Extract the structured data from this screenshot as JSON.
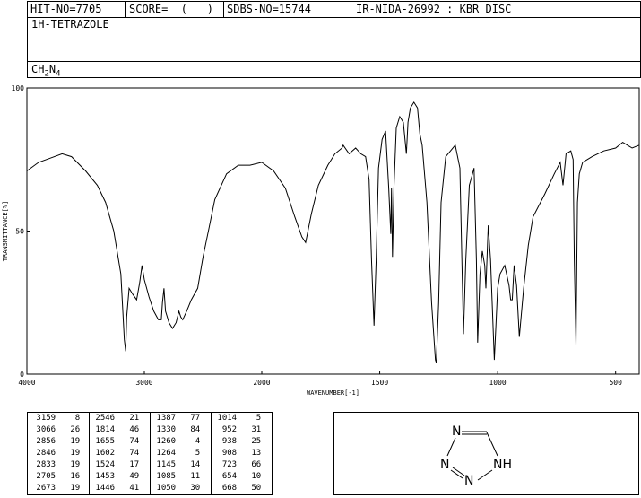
{
  "header": {
    "hit_no": "HIT-NO=7705",
    "score": "SCORE=  (   )",
    "sdbs_no": "SDBS-NO=15744",
    "ir_info": "IR-NIDA-26992 : KBR DISC"
  },
  "compound": {
    "name": "1H-TETRAZOLE",
    "formula_parts": [
      "CH",
      "2",
      "N",
      "4"
    ]
  },
  "chart_data": {
    "type": "line",
    "title": "",
    "xlabel": "WAVENUMBER[-1]",
    "ylabel": "TRANSMITTANCE[%]",
    "xlim": [
      4000,
      400
    ],
    "ylim": [
      0,
      100
    ],
    "x_ticks": [
      4000,
      3000,
      2000,
      1500,
      1000,
      500
    ],
    "x_tick_labels": [
      "4000",
      "3000",
      "2000",
      "1500",
      "1000",
      "500"
    ],
    "y_ticks": [
      0,
      50,
      100
    ],
    "y_tick_labels": [
      "0",
      "50",
      "100"
    ],
    "grid": false,
    "series": [
      {
        "points": [
          [
            4000,
            71
          ],
          [
            3900,
            74
          ],
          [
            3800,
            75.5
          ],
          [
            3700,
            77
          ],
          [
            3620,
            76
          ],
          [
            3500,
            71
          ],
          [
            3400,
            66
          ],
          [
            3330,
            60
          ],
          [
            3260,
            50
          ],
          [
            3200,
            35
          ],
          [
            3170,
            12
          ],
          [
            3159,
            8
          ],
          [
            3150,
            20
          ],
          [
            3130,
            30
          ],
          [
            3100,
            28
          ],
          [
            3066,
            26
          ],
          [
            3040,
            32
          ],
          [
            3020,
            38
          ],
          [
            3000,
            33
          ],
          [
            2960,
            27
          ],
          [
            2920,
            22
          ],
          [
            2880,
            19
          ],
          [
            2856,
            19
          ],
          [
            2846,
            25
          ],
          [
            2833,
            30
          ],
          [
            2820,
            22
          ],
          [
            2790,
            18
          ],
          [
            2760,
            16
          ],
          [
            2730,
            18
          ],
          [
            2705,
            22
          ],
          [
            2690,
            20
          ],
          [
            2673,
            19
          ],
          [
            2640,
            22
          ],
          [
            2600,
            26
          ],
          [
            2546,
            30
          ],
          [
            2500,
            41
          ],
          [
            2450,
            51
          ],
          [
            2400,
            61
          ],
          [
            2300,
            70
          ],
          [
            2200,
            73
          ],
          [
            2100,
            73
          ],
          [
            2000,
            74
          ],
          [
            1950,
            71
          ],
          [
            1900,
            65
          ],
          [
            1860,
            55
          ],
          [
            1830,
            48
          ],
          [
            1814,
            46
          ],
          [
            1790,
            56
          ],
          [
            1760,
            66
          ],
          [
            1720,
            73
          ],
          [
            1690,
            77
          ],
          [
            1660,
            79
          ],
          [
            1655,
            80
          ],
          [
            1630,
            77
          ],
          [
            1602,
            79
          ],
          [
            1580,
            77
          ],
          [
            1560,
            76
          ],
          [
            1545,
            68
          ],
          [
            1535,
            40
          ],
          [
            1524,
            17
          ],
          [
            1515,
            40
          ],
          [
            1505,
            72
          ],
          [
            1490,
            82
          ],
          [
            1475,
            85
          ],
          [
            1462,
            65
          ],
          [
            1453,
            49
          ],
          [
            1450,
            65
          ],
          [
            1446,
            41
          ],
          [
            1440,
            65
          ],
          [
            1430,
            86
          ],
          [
            1415,
            90
          ],
          [
            1400,
            88
          ],
          [
            1387,
            77
          ],
          [
            1380,
            88
          ],
          [
            1370,
            93
          ],
          [
            1355,
            95
          ],
          [
            1340,
            93
          ],
          [
            1330,
            84
          ],
          [
            1320,
            80
          ],
          [
            1300,
            60
          ],
          [
            1280,
            25
          ],
          [
            1264,
            5
          ],
          [
            1260,
            4
          ],
          [
            1250,
            25
          ],
          [
            1240,
            60
          ],
          [
            1220,
            76
          ],
          [
            1200,
            78
          ],
          [
            1180,
            80
          ],
          [
            1160,
            72
          ],
          [
            1145,
            14
          ],
          [
            1135,
            40
          ],
          [
            1120,
            66
          ],
          [
            1110,
            69
          ],
          [
            1100,
            72
          ],
          [
            1090,
            40
          ],
          [
            1085,
            11
          ],
          [
            1075,
            35
          ],
          [
            1065,
            43
          ],
          [
            1055,
            38
          ],
          [
            1050,
            30
          ],
          [
            1040,
            52
          ],
          [
            1030,
            40
          ],
          [
            1014,
            5
          ],
          [
            1000,
            30
          ],
          [
            990,
            35
          ],
          [
            970,
            38
          ],
          [
            952,
            31
          ],
          [
            945,
            26
          ],
          [
            938,
            26
          ],
          [
            930,
            38
          ],
          [
            920,
            31
          ],
          [
            908,
            13
          ],
          [
            890,
            30
          ],
          [
            870,
            45
          ],
          [
            850,
            55
          ],
          [
            800,
            63
          ],
          [
            760,
            70
          ],
          [
            735,
            74
          ],
          [
            723,
            66
          ],
          [
            710,
            77
          ],
          [
            690,
            78
          ],
          [
            680,
            75
          ],
          [
            675,
            40
          ],
          [
            668,
            10
          ],
          [
            662,
            60
          ],
          [
            654,
            70
          ],
          [
            640,
            74
          ],
          [
            600,
            76
          ],
          [
            550,
            78
          ],
          [
            500,
            79
          ],
          [
            470,
            81
          ],
          [
            450,
            80
          ],
          [
            430,
            79
          ],
          [
            400,
            80
          ]
        ]
      }
    ],
    "peak_table": [
      [
        3159,
        8
      ],
      [
        3066,
        26
      ],
      [
        2856,
        19
      ],
      [
        2846,
        19
      ],
      [
        2833,
        19
      ],
      [
        2705,
        16
      ],
      [
        2673,
        19
      ],
      [
        2546,
        21
      ],
      [
        1814,
        46
      ],
      [
        1655,
        74
      ],
      [
        1602,
        74
      ],
      [
        1524,
        17
      ],
      [
        1453,
        49
      ],
      [
        1446,
        41
      ],
      [
        1387,
        77
      ],
      [
        1330,
        84
      ],
      [
        1260,
        4
      ],
      [
        1264,
        5
      ],
      [
        1145,
        14
      ],
      [
        1085,
        11
      ],
      [
        1050,
        30
      ],
      [
        1014,
        5
      ],
      [
        952,
        31
      ],
      [
        938,
        25
      ],
      [
        908,
        13
      ],
      [
        723,
        66
      ],
      [
        654,
        10
      ],
      [
        668,
        50
      ]
    ]
  },
  "structure": {
    "atom_n1": "N",
    "atom_n2": "N",
    "atom_n3": "N",
    "atom_nh": "NH",
    "line_color": "#000000"
  }
}
